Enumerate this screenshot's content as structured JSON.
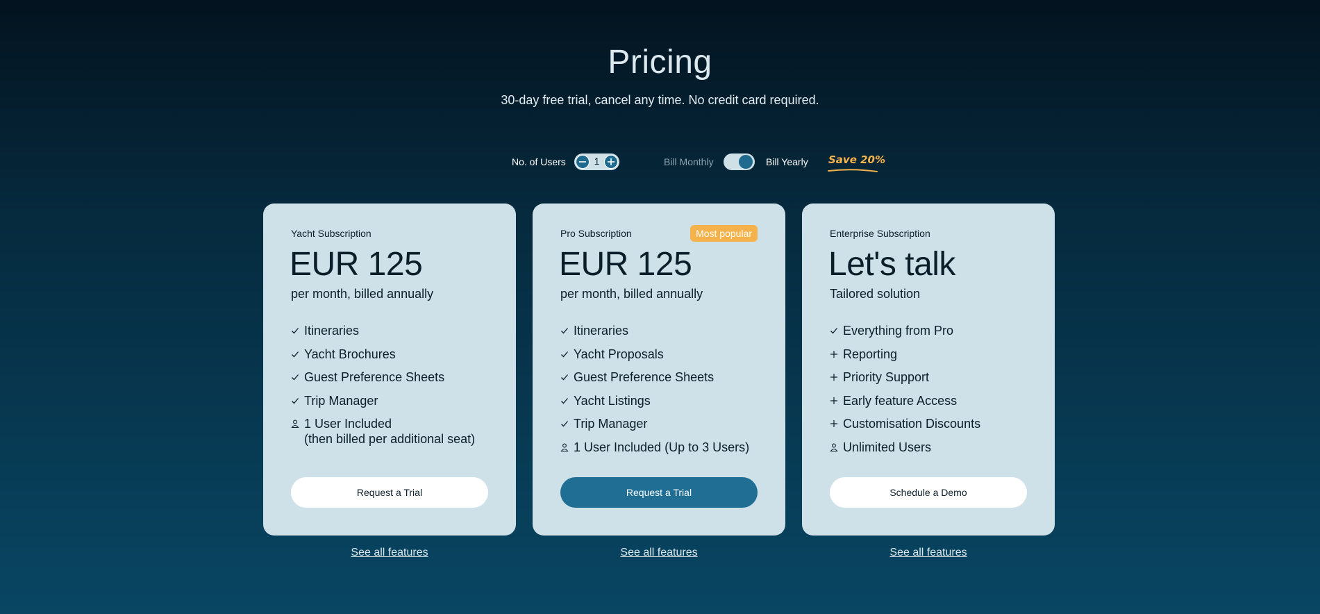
{
  "header": {
    "title": "Pricing",
    "subtitle": "30-day free trial, cancel any time. No credit card required."
  },
  "controls": {
    "users_label": "No. of Users",
    "users_value": "1",
    "minus_icon": "minus-icon",
    "plus_icon": "plus-icon",
    "bill_monthly": "Bill Monthly",
    "bill_yearly": "Bill Yearly",
    "billing_selected": "yearly",
    "save_badge": "Save 20%"
  },
  "colors": {
    "accent": "#216e95",
    "badge": "#f6b24a",
    "card_bg": "#cfe1e8"
  },
  "plans": [
    {
      "name": "Yacht Subscription",
      "price": "EUR 125",
      "period": "per month, billed annually",
      "features": [
        {
          "icon": "check-icon",
          "text": "Itineraries"
        },
        {
          "icon": "check-icon",
          "text": "Yacht Brochures"
        },
        {
          "icon": "check-icon",
          "text": "Guest Preference Sheets"
        },
        {
          "icon": "check-icon",
          "text": "Trip Manager"
        },
        {
          "icon": "user-icon",
          "text": "1 User Included",
          "text2": "(then billed per additional seat)"
        }
      ],
      "cta": "Request a Trial",
      "see_all": "See all features"
    },
    {
      "name": "Pro Subscription",
      "badge": "Most popular",
      "price": "EUR 125",
      "period": "per month, billed annually",
      "features": [
        {
          "icon": "check-icon",
          "text": "Itineraries"
        },
        {
          "icon": "check-icon",
          "text": "Yacht Proposals"
        },
        {
          "icon": "check-icon",
          "text": "Guest Preference Sheets"
        },
        {
          "icon": "check-icon",
          "text": "Yacht Listings"
        },
        {
          "icon": "check-icon",
          "text": "Trip Manager"
        },
        {
          "icon": "user-icon",
          "text": "1 User Included (Up to 3 Users)"
        }
      ],
      "cta": "Request a Trial",
      "see_all": "See all features"
    },
    {
      "name": "Enterprise Subscription",
      "price": "Let's talk",
      "period": "Tailored solution",
      "features": [
        {
          "icon": "check-icon",
          "text": "Everything from Pro"
        },
        {
          "icon": "plus-icon",
          "text": "Reporting"
        },
        {
          "icon": "plus-icon",
          "text": "Priority Support"
        },
        {
          "icon": "plus-icon",
          "text": "Early feature Access"
        },
        {
          "icon": "plus-icon",
          "text": "Customisation Discounts"
        },
        {
          "icon": "user-icon",
          "text": "Unlimited Users"
        }
      ],
      "cta": "Schedule a Demo",
      "see_all": "See all features"
    }
  ]
}
